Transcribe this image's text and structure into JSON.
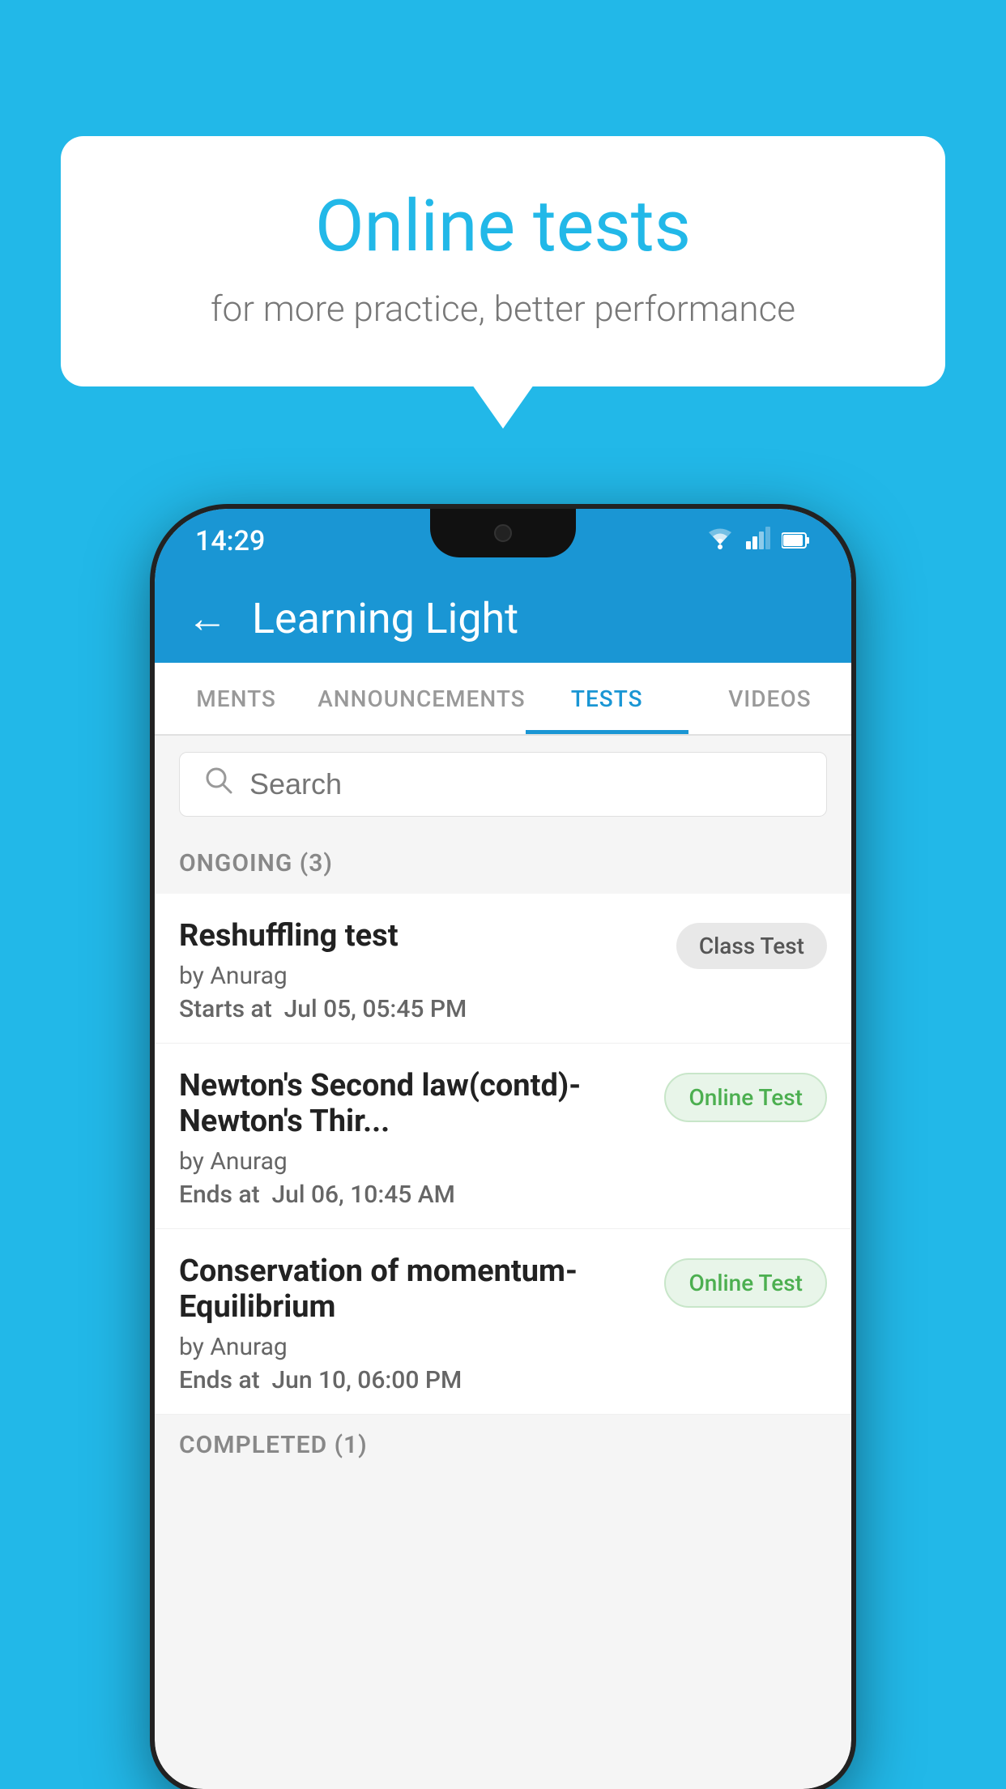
{
  "background": {
    "color": "#22b8e8"
  },
  "speech_bubble": {
    "title": "Online tests",
    "subtitle": "for more practice, better performance"
  },
  "phone": {
    "status_bar": {
      "time": "14:29",
      "icons": [
        "wifi",
        "signal",
        "battery"
      ]
    },
    "app_bar": {
      "title": "Learning Light",
      "back_label": "←"
    },
    "tabs": [
      {
        "label": "MENTS",
        "active": false
      },
      {
        "label": "ANNOUNCEMENTS",
        "active": false
      },
      {
        "label": "TESTS",
        "active": true
      },
      {
        "label": "VIDEOS",
        "active": false
      }
    ],
    "search": {
      "placeholder": "Search"
    },
    "ongoing_section": {
      "label": "ONGOING (3)"
    },
    "test_items": [
      {
        "name": "Reshuffling test",
        "author": "by Anurag",
        "time_label": "Starts at",
        "time_value": "Jul 05, 05:45 PM",
        "badge": "Class Test",
        "badge_type": "class"
      },
      {
        "name": "Newton's Second law(contd)-Newton's Thir...",
        "author": "by Anurag",
        "time_label": "Ends at",
        "time_value": "Jul 06, 10:45 AM",
        "badge": "Online Test",
        "badge_type": "online"
      },
      {
        "name": "Conservation of momentum-Equilibrium",
        "author": "by Anurag",
        "time_label": "Ends at",
        "time_value": "Jun 10, 06:00 PM",
        "badge": "Online Test",
        "badge_type": "online"
      }
    ],
    "completed_section": {
      "label": "COMPLETED (1)"
    }
  }
}
